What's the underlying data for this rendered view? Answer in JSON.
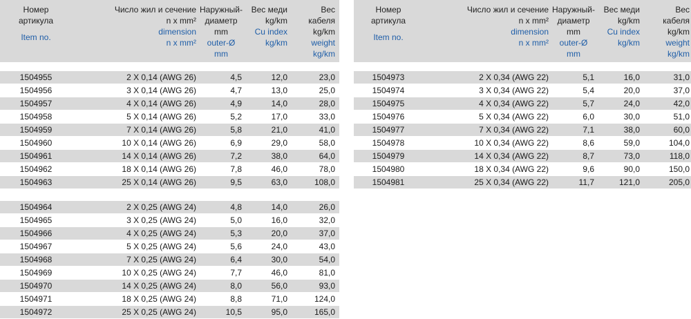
{
  "headers": {
    "article": {
      "ru": [
        "Номер",
        "артикула"
      ],
      "en": "Item no."
    },
    "dimension": {
      "ru": [
        "Число жил и сечение",
        "n x mm²"
      ],
      "en": [
        "dimension",
        "n x mm²"
      ]
    },
    "diameter": {
      "ru": [
        "Наружный-",
        "диаметр",
        "mm"
      ],
      "en": [
        "outer-Ø",
        "mm"
      ]
    },
    "cu": {
      "ru": [
        "Вес меди",
        "kg/km"
      ],
      "en": [
        "Cu index",
        "kg/km"
      ]
    },
    "weight": {
      "ru": [
        "Вес",
        "кабеля",
        "kg/km"
      ],
      "en": [
        "weight",
        "kg/km"
      ]
    }
  },
  "left_table": {
    "groups": [
      {
        "rows": [
          [
            "1504955",
            "2 X 0,14 (AWG 26)",
            "4,5",
            "12,0",
            "23,0"
          ],
          [
            "1504956",
            "3 X 0,14 (AWG 26)",
            "4,7",
            "13,0",
            "25,0"
          ],
          [
            "1504957",
            "4 X 0,14 (AWG 26)",
            "4,9",
            "14,0",
            "28,0"
          ],
          [
            "1504958",
            "5 X 0,14 (AWG 26)",
            "5,2",
            "17,0",
            "33,0"
          ],
          [
            "1504959",
            "7 X 0,14 (AWG 26)",
            "5,8",
            "21,0",
            "41,0"
          ],
          [
            "1504960",
            "10 X 0,14 (AWG 26)",
            "6,9",
            "29,0",
            "58,0"
          ],
          [
            "1504961",
            "14 X 0,14 (AWG 26)",
            "7,2",
            "38,0",
            "64,0"
          ],
          [
            "1504962",
            "18 X 0,14 (AWG 26)",
            "7,8",
            "46,0",
            "78,0"
          ],
          [
            "1504963",
            "25 X 0,14 (AWG 26)",
            "9,5",
            "63,0",
            "108,0"
          ]
        ]
      },
      {
        "rows": [
          [
            "1504964",
            "2 X 0,25 (AWG 24)",
            "4,8",
            "14,0",
            "26,0"
          ],
          [
            "1504965",
            "3 X 0,25 (AWG 24)",
            "5,0",
            "16,0",
            "32,0"
          ],
          [
            "1504966",
            "4 X 0,25 (AWG 24)",
            "5,3",
            "20,0",
            "37,0"
          ],
          [
            "1504967",
            "5 X 0,25 (AWG 24)",
            "5,6",
            "24,0",
            "43,0"
          ],
          [
            "1504968",
            "7 X 0,25 (AWG 24)",
            "6,4",
            "30,0",
            "54,0"
          ],
          [
            "1504969",
            "10 X 0,25 (AWG 24)",
            "7,7",
            "46,0",
            "81,0"
          ],
          [
            "1504970",
            "14 X 0,25 (AWG 24)",
            "8,0",
            "56,0",
            "93,0"
          ],
          [
            "1504971",
            "18 X 0,25 (AWG 24)",
            "8,8",
            "71,0",
            "124,0"
          ],
          [
            "1504972",
            "25 X 0,25 (AWG 24)",
            "10,5",
            "95,0",
            "165,0"
          ]
        ]
      }
    ]
  },
  "right_table": {
    "groups": [
      {
        "rows": [
          [
            "1504973",
            "2 X 0,34 (AWG 22)",
            "5,1",
            "16,0",
            "31,0"
          ],
          [
            "1504974",
            "3 X 0,34 (AWG 22)",
            "5,4",
            "20,0",
            "37,0"
          ],
          [
            "1504975",
            "4 X 0,34 (AWG 22)",
            "5,7",
            "24,0",
            "42,0"
          ],
          [
            "1504976",
            "5 X 0,34 (AWG 22)",
            "6,0",
            "30,0",
            "51,0"
          ],
          [
            "1504977",
            "7 X 0,34 (AWG 22)",
            "7,1",
            "38,0",
            "60,0"
          ],
          [
            "1504978",
            "10 X 0,34 (AWG 22)",
            "8,6",
            "59,0",
            "104,0"
          ],
          [
            "1504979",
            "14 X 0,34 (AWG 22)",
            "8,7",
            "73,0",
            "118,0"
          ],
          [
            "1504980",
            "18 X 0,34 (AWG 22)",
            "9,6",
            "90,0",
            "150,0"
          ],
          [
            "1504981",
            "25 X 0,34 (AWG 22)",
            "11,7",
            "121,0",
            "205,0"
          ]
        ]
      }
    ]
  }
}
